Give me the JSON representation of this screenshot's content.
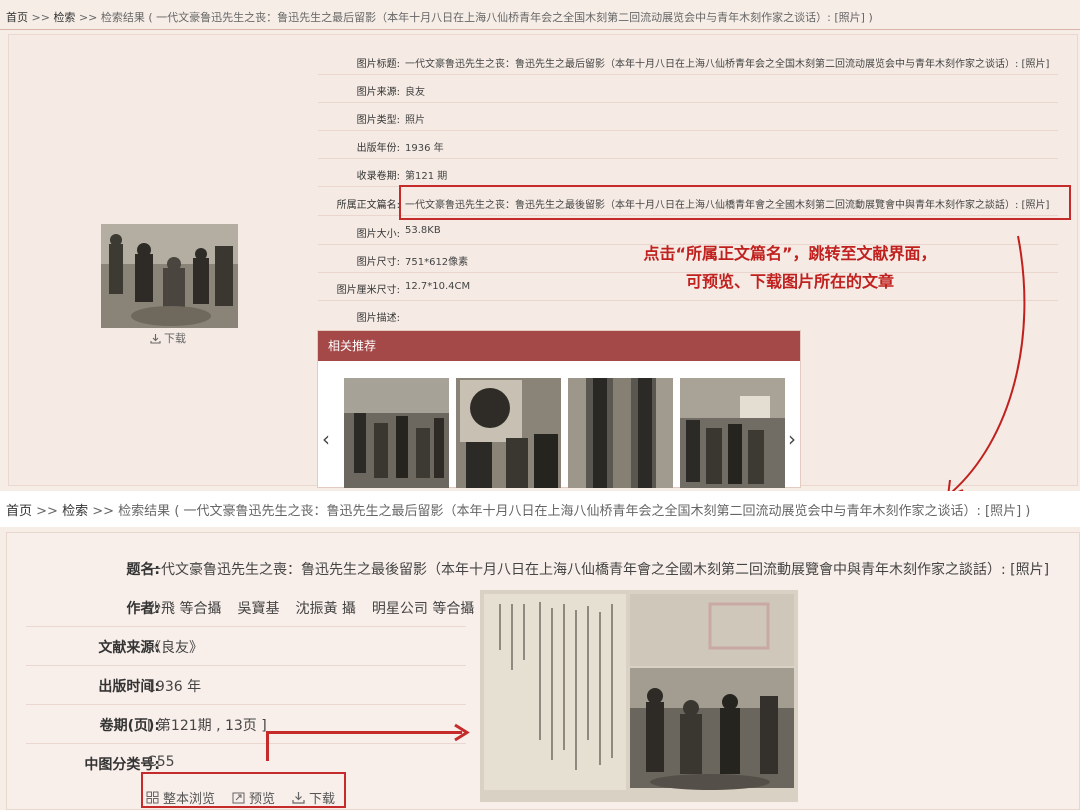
{
  "top": {
    "breadcrumb": {
      "home": "首页",
      "search": "检索",
      "results": "检索结果",
      "query": "( 一代文豪鲁迅先生之丧：鲁迅先生之最后留影（本年十月八日在上海八仙桥青年会之全国木刻第二回流动展览会中与青年木刻作家之谈话）: [照片] )"
    },
    "download_label": "下载",
    "fields": [
      {
        "label": "图片标题:",
        "value": "一代文豪鲁迅先生之丧：鲁迅先生之最后留影（本年十月八日在上海八仙桥青年会之全国木刻第二回流动展览会中与青年木刻作家之谈话）: [照片]"
      },
      {
        "label": "图片来源:",
        "value": "良友"
      },
      {
        "label": "图片类型:",
        "value": "照片"
      },
      {
        "label": "出版年份:",
        "value": "1936 年"
      },
      {
        "label": "收录卷期:",
        "value": "第121 期"
      },
      {
        "label": "所属正文篇名:",
        "value": "一代文豪鲁迅先生之丧：鲁迅先生之最後留影（本年十月八日在上海八仙橋青年會之全國木刻第二回流動展覽會中與青年木刻作家之談話）: [照片]"
      },
      {
        "label": "图片大小:",
        "value": "53.8KB"
      },
      {
        "label": "图片尺寸:",
        "value": "751*612像素"
      },
      {
        "label": "图片厘米尺寸:",
        "value": "12.7*10.4CM"
      },
      {
        "label": "图片描述:",
        "value": ""
      }
    ],
    "related_title": "相关推荐"
  },
  "callout": {
    "line1": "点击“所属正文篇名”，跳转至文献界面，",
    "line2": "可预览、下载图片所在的文章"
  },
  "bottom": {
    "breadcrumb": {
      "home": "首页",
      "search": "检索",
      "results": "检索结果",
      "query": "( 一代文豪鲁迅先生之丧：鲁迅先生之最后留影（本年十月八日在上海八仙桥青年会之全国木刻第二回流动展览会中与青年木刻作家之谈话）: [照片] )"
    },
    "title_label": "题名:",
    "title_value": "一代文豪鲁迅先生之喪：鲁迅先生之最後留影（本年十月八日在上海八仙橋青年會之全國木刻第二回流動展覽會中與青年木刻作家之談話）: [照片]",
    "authors_label": "作者:",
    "authors": [
      "沙飛 等合攝",
      "吳寶基",
      "沈振黃 攝",
      "明星公司 等合攝"
    ],
    "source_label": "文献来源:",
    "source_value": "《良友》",
    "pubtime_label": "出版时间:",
    "pubtime_value": "1936 年",
    "issue_label": "卷期(页):",
    "issue_value": "[ 第121期 , 13页 ]",
    "clc_label": "中图分类号:",
    "clc_value": "C55",
    "actions": {
      "browse": "整本浏览",
      "preview": "预览",
      "download": "下载"
    }
  },
  "colors": {
    "accent": "#a44848",
    "highlight": "#c52b2b",
    "background": "#f6ede7"
  }
}
